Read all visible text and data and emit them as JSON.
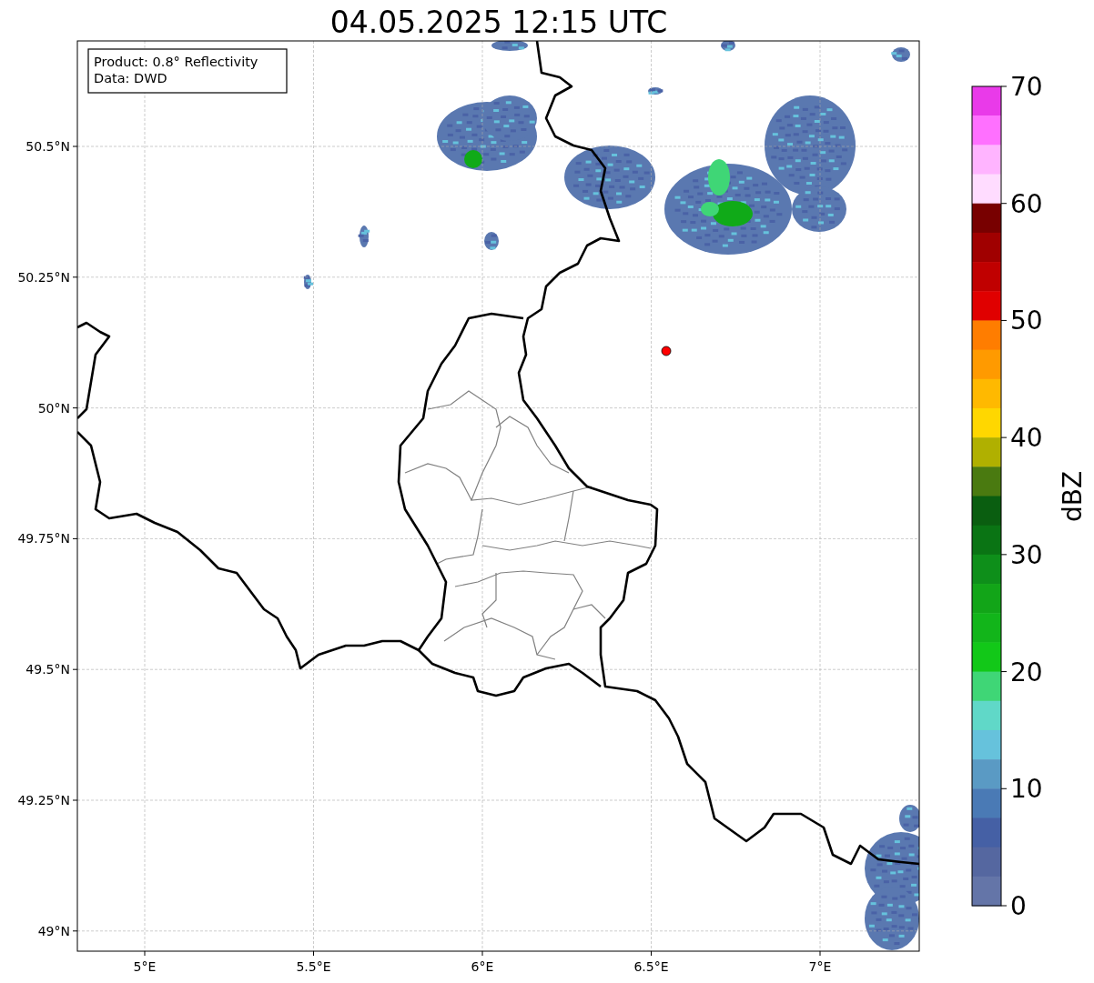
{
  "map": {
    "title": "04.05.2025 12:15 UTC",
    "lat_ticks": [
      "50.5°N",
      "50.25°N",
      "50°N",
      "49.75°N",
      "49.5°N",
      "49.25°N",
      "49°N"
    ],
    "lon_ticks": [
      "5°E",
      "5.5°E",
      "6°E",
      "6.5°E",
      "7°E"
    ]
  },
  "info_box": [
    "Product: 0.8° Reflectivity",
    "Data: DWD"
  ],
  "colorbar": {
    "ticks": [
      "70",
      "60",
      "50",
      "40",
      "30",
      "20",
      "10",
      "0"
    ],
    "label": "dBZ",
    "bands": [
      {
        "color": "#e93ae9"
      },
      {
        "color": "#ff70ff"
      },
      {
        "color": "#ffb4ff"
      },
      {
        "color": "#ffdcff"
      },
      {
        "color": "#780000"
      },
      {
        "color": "#a00000"
      },
      {
        "color": "#c00000"
      },
      {
        "color": "#e00000"
      },
      {
        "color": "#ff7d00"
      },
      {
        "color": "#ff9a00"
      },
      {
        "color": "#ffb900"
      },
      {
        "color": "#ffd700"
      },
      {
        "color": "#b0b000"
      },
      {
        "color": "#4a7a10"
      },
      {
        "color": "#0a5e10"
      },
      {
        "color": "#0a7414"
      },
      {
        "color": "#0e8f1a"
      },
      {
        "color": "#12a518"
      },
      {
        "color": "#12b51a"
      },
      {
        "color": "#12c818"
      },
      {
        "color": "#3fd676"
      },
      {
        "color": "#60d8c8"
      },
      {
        "color": "#66c2dc"
      },
      {
        "color": "#5a9ac4"
      },
      {
        "color": "#4a7ab5"
      },
      {
        "color": "#4560a5"
      },
      {
        "color": "#5567a0"
      },
      {
        "color": "#6475a8"
      }
    ]
  }
}
